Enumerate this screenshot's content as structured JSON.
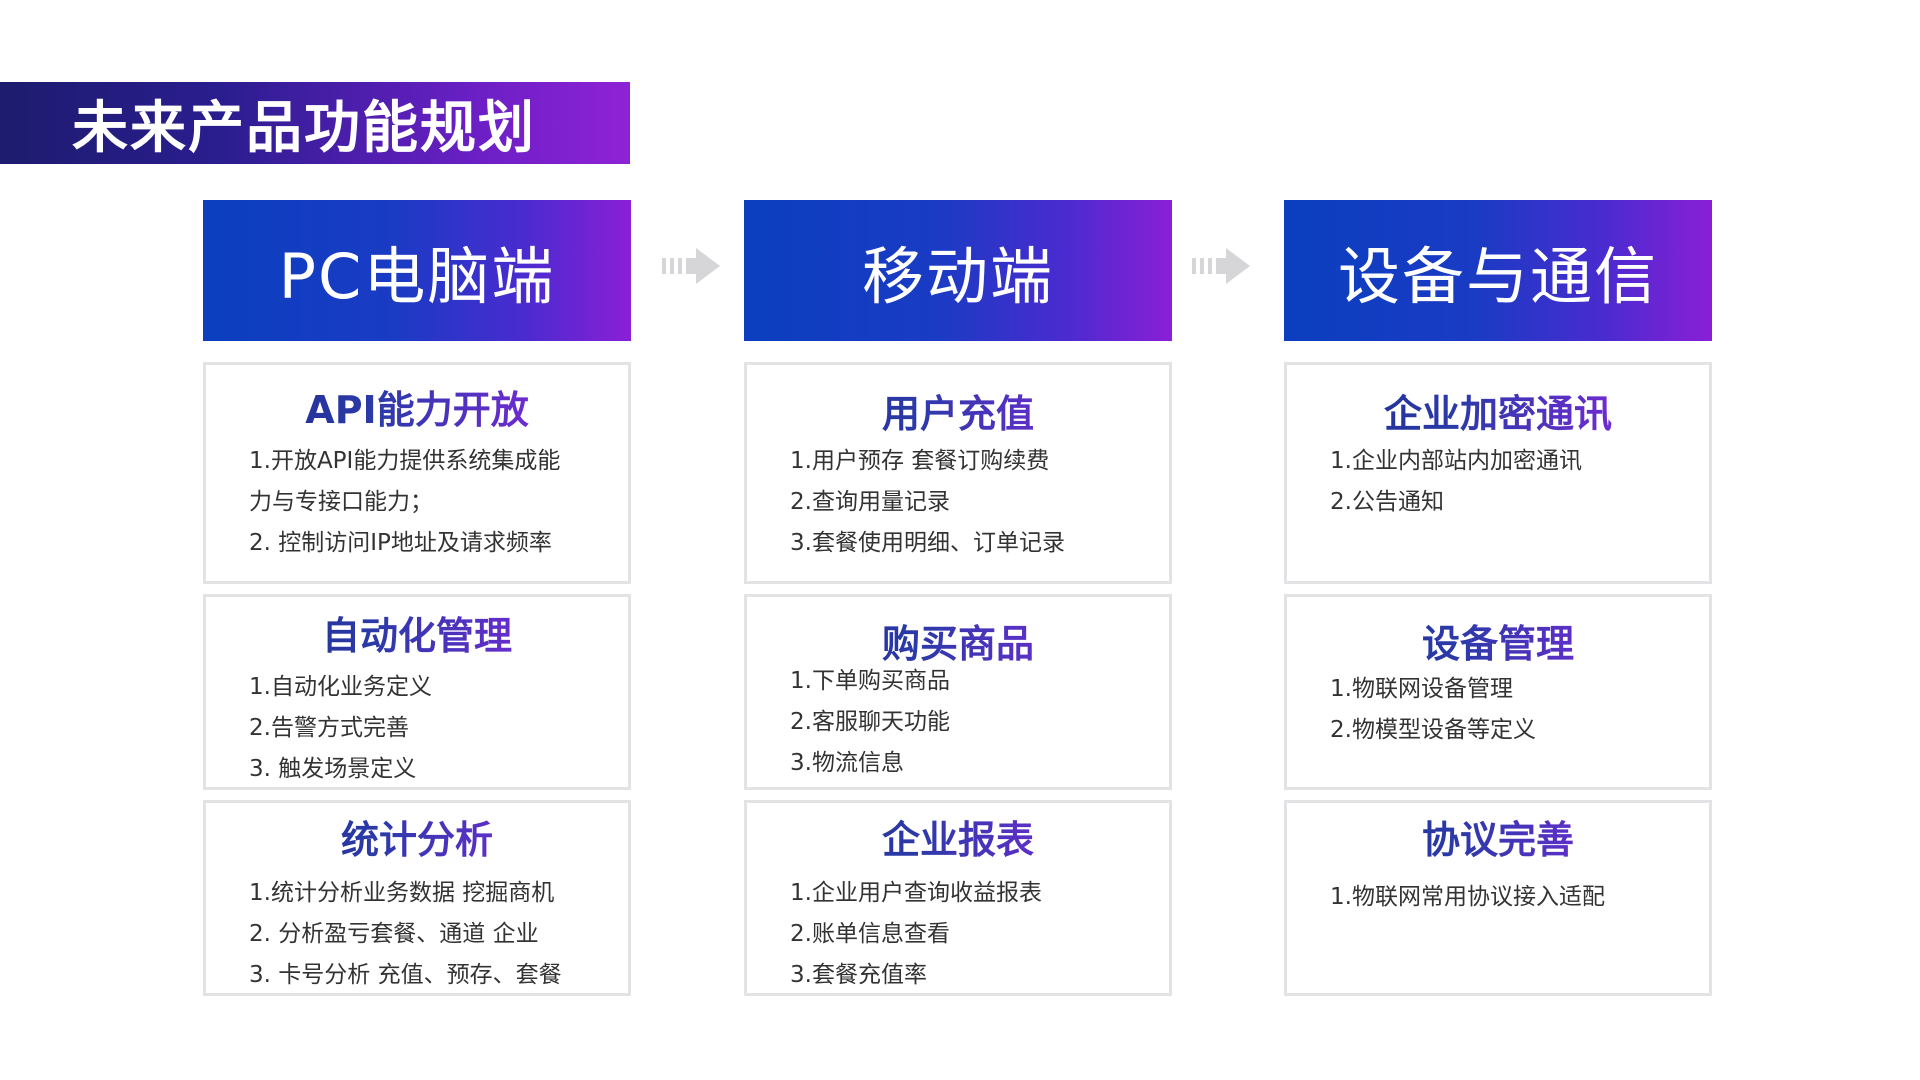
{
  "slide_title": "未来产品功能规划",
  "arrow_icon": "double-chevron-arrow-icon",
  "columns": [
    {
      "header": "PC电脑端",
      "cards": [
        {
          "title": "API能力开放",
          "lines": [
            "1.开放API能力提供系统集成能",
            "力与专接口能力；",
            "2. 控制访问IP地址及请求频率"
          ]
        },
        {
          "title": "自动化管理",
          "lines": [
            "1.自动化业务定义",
            "2.告警方式完善",
            "3. 触发场景定义"
          ]
        },
        {
          "title": "统计分析",
          "lines": [
            "1.统计分析业务数据 挖掘商机",
            "2. 分析盈亏套餐、通道 企业",
            "3. 卡号分析 充值、预存、套餐"
          ]
        }
      ]
    },
    {
      "header": "移动端",
      "cards": [
        {
          "title": "用户充值",
          "lines": [
            "1.用户预存 套餐订购续费",
            "2.查询用量记录",
            "3.套餐使用明细、订单记录"
          ]
        },
        {
          "title": "购买商品",
          "lines": [
            "1.下单购买商品",
            "2.客服聊天功能",
            "3.物流信息"
          ]
        },
        {
          "title": "企业报表",
          "lines": [
            "1.企业用户查询收益报表",
            "2.账单信息查看",
            "3.套餐充值率"
          ]
        }
      ]
    },
    {
      "header": "设备与通信",
      "cards": [
        {
          "title": "企业加密通讯",
          "lines": [
            "1.企业内部站内加密通讯",
            "2.公告通知"
          ]
        },
        {
          "title": "设备管理",
          "lines": [
            "1.物联网设备管理",
            "2.物模型设备等定义"
          ]
        },
        {
          "title": "协议完善",
          "lines": [
            "1.物联网常用协议接入适配"
          ]
        }
      ]
    }
  ]
}
